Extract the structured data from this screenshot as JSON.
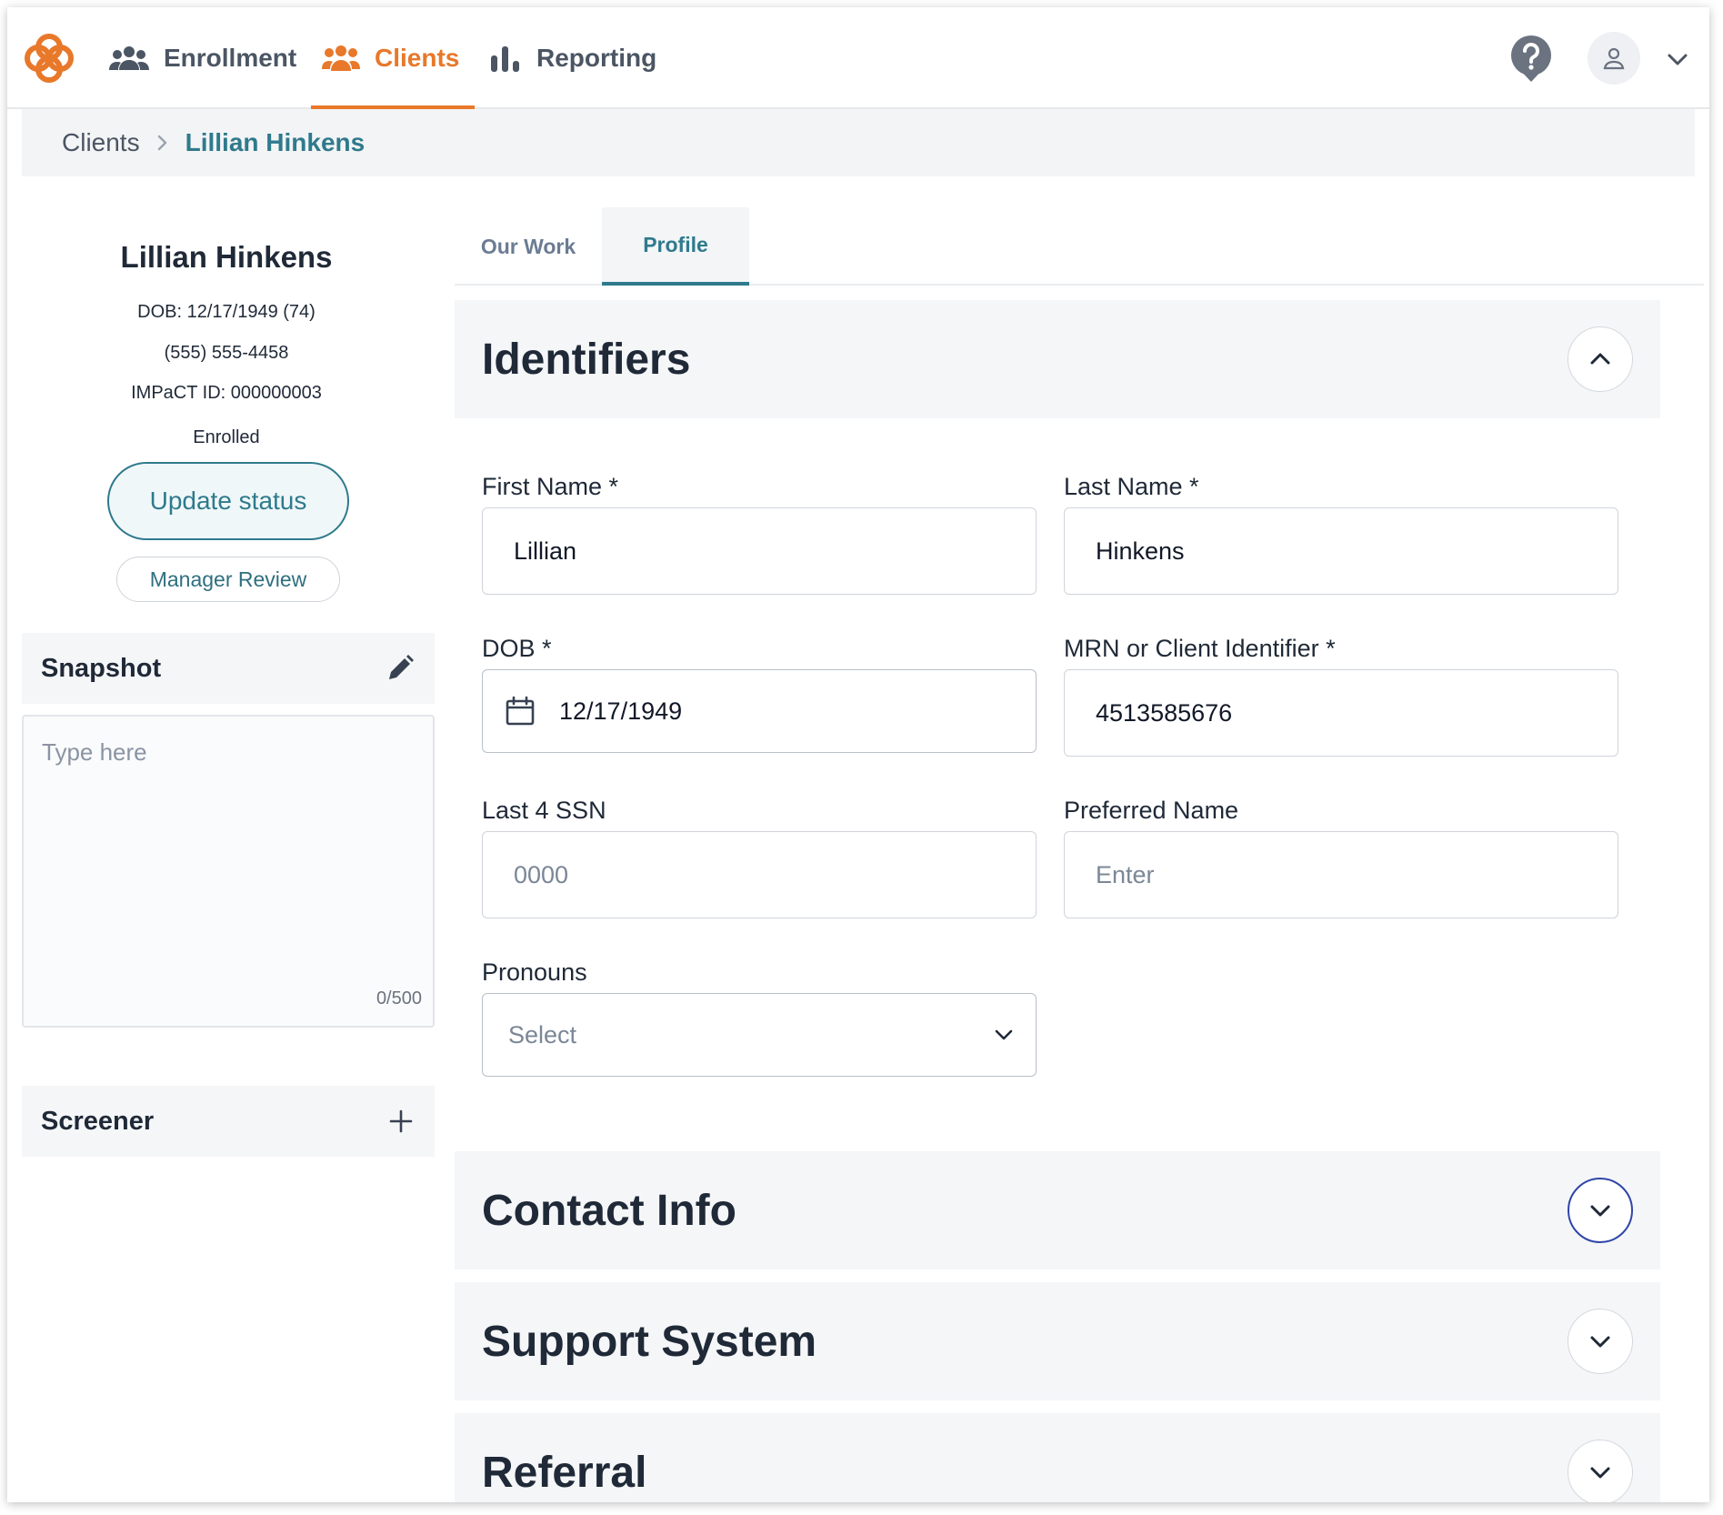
{
  "nav": {
    "items": [
      {
        "label": "Enrollment",
        "icon": "people-group-icon"
      },
      {
        "label": "Clients",
        "icon": "clients-icon",
        "active": true
      },
      {
        "label": "Reporting",
        "icon": "bar-chart-icon"
      }
    ],
    "accent_color": "#e8782a"
  },
  "breadcrumb": {
    "parent": "Clients",
    "current": "Lillian Hinkens"
  },
  "client": {
    "name": "Lillian Hinkens",
    "dob": "DOB: 12/17/1949 (74)",
    "phone": "(555) 555-4458",
    "impact_id": "IMPaCT ID: 000000003",
    "status": "Enrolled",
    "update_status_label": "Update status",
    "manager_review_label": "Manager Review"
  },
  "snapshot": {
    "title": "Snapshot",
    "placeholder": "Type here",
    "counter": "0/500"
  },
  "screener": {
    "title": "Screener"
  },
  "tabs": [
    {
      "label": "Our Work"
    },
    {
      "label": "Profile",
      "active": true
    }
  ],
  "identifiers": {
    "title": "Identifiers",
    "first_name": {
      "label": "First Name *",
      "value": "Lillian"
    },
    "last_name": {
      "label": "Last Name *",
      "value": "Hinkens"
    },
    "dob": {
      "label": "DOB *",
      "value": "12/17/1949"
    },
    "mrn": {
      "label": "MRN or Client Identifier *",
      "value": "4513585676"
    },
    "ssn": {
      "label": "Last 4 SSN",
      "placeholder": "0000"
    },
    "preferred_name": {
      "label": "Preferred Name",
      "placeholder": "Enter"
    },
    "pronouns": {
      "label": "Pronouns",
      "placeholder": "Select"
    }
  },
  "sections": [
    {
      "title": "Contact Info"
    },
    {
      "title": "Support System"
    },
    {
      "title": "Referral"
    }
  ],
  "colors": {
    "teal": "#2f7a8c",
    "focus_blue": "#2f45a8"
  }
}
